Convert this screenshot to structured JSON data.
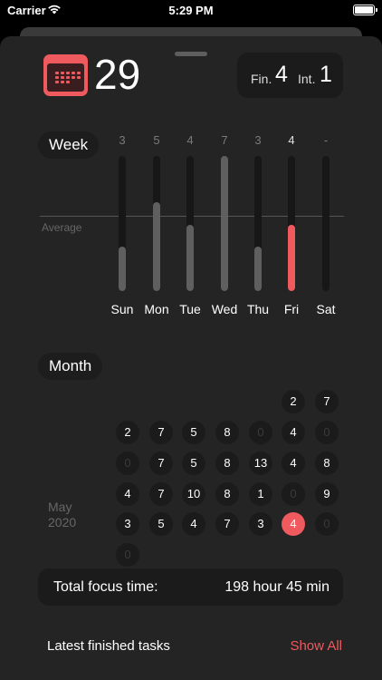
{
  "status": {
    "carrier": "Carrier",
    "time": "5:29 PM"
  },
  "colors": {
    "accent": "#ef5a5f",
    "sheet": "#242424",
    "card": "#1b1b1b"
  },
  "summary": {
    "count": "29",
    "fin_label": "Fin.",
    "fin_value": "4",
    "int_label": "Int.",
    "int_value": "1"
  },
  "week": {
    "label": "Week",
    "average_label": "Average",
    "days": [
      {
        "name": "Sun",
        "count": "3",
        "level": 0.33,
        "active": false
      },
      {
        "name": "Mon",
        "count": "5",
        "level": 0.66,
        "active": false
      },
      {
        "name": "Tue",
        "count": "4",
        "level": 0.49,
        "active": false
      },
      {
        "name": "Wed",
        "count": "7",
        "level": 1.0,
        "active": false
      },
      {
        "name": "Thu",
        "count": "3",
        "level": 0.33,
        "active": false
      },
      {
        "name": "Fri",
        "count": "4",
        "level": 0.49,
        "active": true
      },
      {
        "name": "Sat",
        "count": "-",
        "level": 0,
        "active": false
      }
    ]
  },
  "month": {
    "label": "Month",
    "caption_line1": "May",
    "caption_line2": "2020",
    "weeks": [
      [
        "",
        "",
        "",
        "",
        "",
        "2",
        "7"
      ],
      [
        "2",
        "7",
        "5",
        "8",
        "0",
        "4",
        "0"
      ],
      [
        "0",
        "7",
        "5",
        "8",
        "13",
        "4",
        "8"
      ],
      [
        "4",
        "7",
        "10",
        "8",
        "1",
        "0",
        "9"
      ],
      [
        "3",
        "5",
        "4",
        "7",
        "3",
        "4",
        "0"
      ],
      [
        "0",
        "",
        "",
        "",
        "",
        "",
        ""
      ]
    ],
    "today": [
      4,
      5
    ]
  },
  "total": {
    "label": "Total focus time:",
    "value": "198 hour 45 min"
  },
  "bottom": {
    "title": "Latest finished tasks",
    "action": "Show All"
  }
}
